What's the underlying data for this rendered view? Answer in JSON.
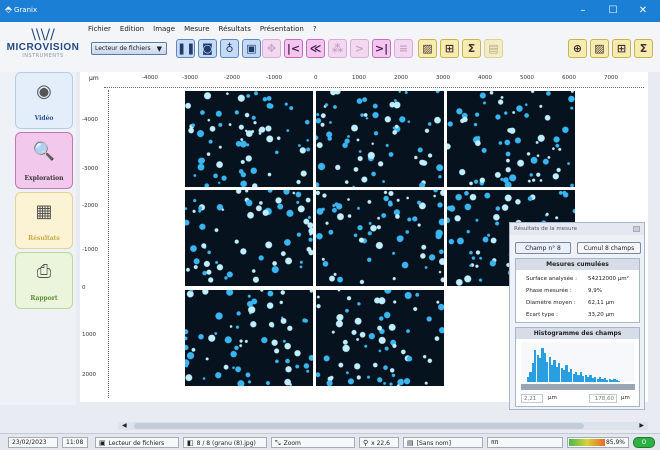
{
  "window": {
    "title": "Granix",
    "app_icon": "granix-icon"
  },
  "logo": {
    "name": "MICROVISION",
    "sub": "INSTRUMENTS"
  },
  "menu": [
    "Fichier",
    "Edition",
    "Image",
    "Mesure",
    "Résultats",
    "Présentation",
    "?"
  ],
  "toolbar": {
    "source_select": "Lecteur de fichiers"
  },
  "sidebar": {
    "items": [
      {
        "label": "Vidéo",
        "icon": "camera-icon"
      },
      {
        "label": "Exploration",
        "icon": "map-search-icon"
      },
      {
        "label": "Résultats",
        "icon": "calculator-icon"
      },
      {
        "label": "Rapport",
        "icon": "printer-icon"
      }
    ]
  },
  "ruler": {
    "unit": "µm",
    "x_ticks": [
      "-4000",
      "-3000",
      "-2000",
      "-1000",
      "0",
      "1000",
      "2000",
      "3000",
      "4000",
      "5000",
      "6000",
      "7000"
    ],
    "y_ticks": [
      "-4000",
      "-3000",
      "-2000",
      "-1000",
      "0",
      "1000",
      "2000"
    ]
  },
  "results": {
    "panel_title": "Résultats de la mesure",
    "btn_field": "Champ n° 8",
    "btn_cumul": "Cumul 8 champs",
    "section_title": "Mesures cumulées",
    "rows": [
      {
        "label": "Surface analysée :",
        "value": "54212000 µm²"
      },
      {
        "label": "Phase mesurée :",
        "value": "9,9%"
      },
      {
        "label": "Diamètre moyen :",
        "value": "62,11 µm"
      },
      {
        "label": "Ecart type :",
        "value": "33,20 µm"
      }
    ],
    "histogram_title": "Histogramme des champs",
    "range_min": "2,21",
    "range_max": "178,60",
    "range_unit": "µm",
    "bar_color": "#2a9fe0"
  },
  "status": {
    "date": "23/02/2023",
    "time": "11:08",
    "source": "Lecteur de fichiers",
    "image": "8 / 8 (granu (8).jpg)",
    "mode": "Zoom",
    "zoom": "x 22,6",
    "name": "[Sans nom]",
    "units": "ππ",
    "progress": "85,9%",
    "ok": "O"
  }
}
